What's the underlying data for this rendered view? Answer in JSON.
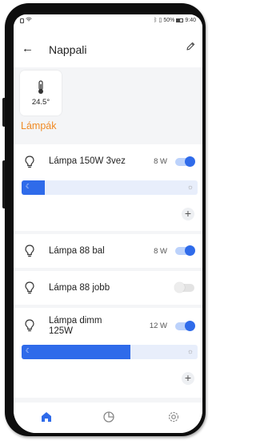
{
  "status_bar": {
    "battery_percent": "50%",
    "time": "9:40"
  },
  "header": {
    "title": "Nappali",
    "back_icon": "arrow-left-icon",
    "edit_icon": "pencil-icon"
  },
  "sensor": {
    "icon": "thermometer-icon",
    "temperature": "24.5°"
  },
  "section": {
    "title": "Lámpák"
  },
  "devices": [
    {
      "name": "Lámpa 150W 3vez",
      "power": "8 W",
      "on": true,
      "dimmable": true,
      "level": 0.13
    },
    {
      "name": "Lámpa 88 bal",
      "power": "8 W",
      "on": true,
      "dimmable": false
    },
    {
      "name": "Lámpa 88 jobb",
      "power": "",
      "on": false,
      "dimmable": false
    },
    {
      "name": "Lámpa dimm 125W",
      "power": "12 W",
      "on": true,
      "dimmable": true,
      "level": 0.62
    }
  ],
  "bottom_nav": [
    "home-icon",
    "pie-chart-icon",
    "settings-icon"
  ],
  "colors": {
    "accent": "#2f6bea",
    "section_title": "#f08a24",
    "toggle_on_track": "#bcd2fb"
  }
}
